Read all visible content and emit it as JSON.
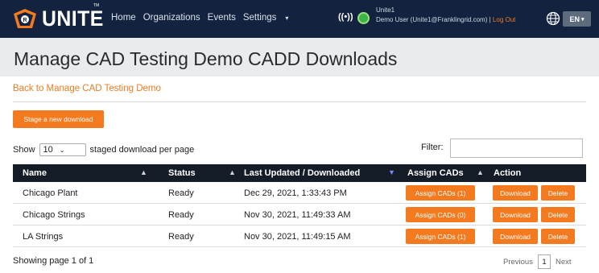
{
  "brand": {
    "name": "UNITE",
    "trademark": "TM"
  },
  "nav": {
    "home": "Home",
    "organizations": "Organizations",
    "events": "Events",
    "settings": "Settings",
    "settings_caret": "▾"
  },
  "user": {
    "signal_glyph": "((•))",
    "account": "Unite1",
    "name_email": "Demo User (Unite1@Franklingrid.com) |",
    "logout": "Log Out"
  },
  "language": {
    "selected": "EN",
    "caret": "▾"
  },
  "page": {
    "title": "Manage CAD Testing Demo CADD Downloads",
    "back_link": "Back to Manage CAD Testing Demo",
    "stage_button": "Stage a new download"
  },
  "list_controls": {
    "show_label": "Show",
    "per_page_value": "10",
    "per_page_suffix": "staged download per page",
    "filter_label": "Filter:",
    "filter_value": ""
  },
  "table": {
    "headers": {
      "name": "Name",
      "status": "Status",
      "last_updated": "Last Updated / Downloaded",
      "assign": "Assign CADs",
      "action": "Action"
    },
    "rows": [
      {
        "name": "Chicago Plant",
        "status": "Ready",
        "updated": "Dec 29, 2021, 1:33:43 PM",
        "assign": "Assign CADs (1)",
        "download": "Download",
        "delete": "Delete"
      },
      {
        "name": "Chicago Strings",
        "status": "Ready",
        "updated": "Nov 30, 2021, 11:49:33 AM",
        "assign": "Assign CADs (0)",
        "download": "Download",
        "delete": "Delete"
      },
      {
        "name": "LA Strings",
        "status": "Ready",
        "updated": "Nov 30, 2021, 11:49:15 AM",
        "assign": "Assign CADs (1)",
        "download": "Download",
        "delete": "Delete"
      }
    ]
  },
  "footer": {
    "showing": "Showing page 1 of 1",
    "previous": "Previous",
    "current_page": "1",
    "next": "Next"
  },
  "colors": {
    "navbar": "#13233f",
    "accent": "#f47a20",
    "table_header": "#141c28",
    "title_bar": "#e9ecef"
  }
}
